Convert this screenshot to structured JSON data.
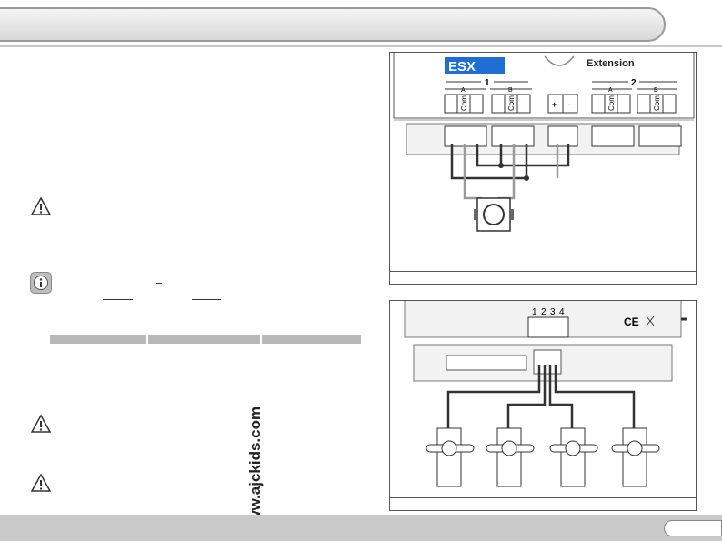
{
  "figure1": {
    "brand": "ESX",
    "module_name": "Extension",
    "group1": "1",
    "group2": "2",
    "port_a": "A",
    "port_b": "B",
    "com": "Com",
    "plus": "+",
    "minus": "-"
  },
  "figure2": {
    "pins": [
      "1",
      "2",
      "3",
      "4"
    ],
    "pin_minus": "-",
    "pin_plus": "+",
    "ce_mark": "CE"
  },
  "website": "www.ajckids.com",
  "colors": {
    "header": "#dcdcdc",
    "footer": "#c9c9c9",
    "lcd": "#1d6fd6",
    "wire_dark": "#333333",
    "wire_gray": "#9a9a9a"
  }
}
